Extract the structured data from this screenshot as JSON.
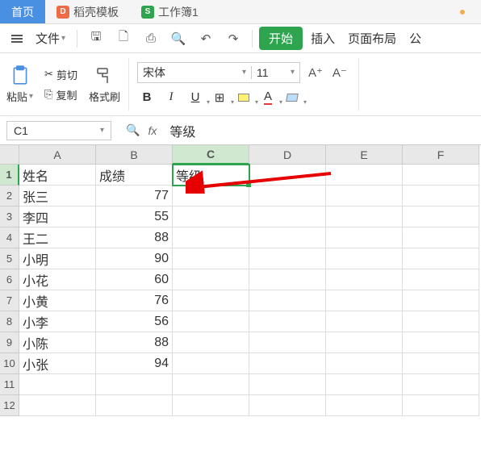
{
  "tabs": {
    "home": "首页",
    "docer": "稻壳模板",
    "workbook": "工作簿1"
  },
  "menubar": {
    "file": "文件",
    "start": "开始",
    "insert": "插入",
    "page_layout": "页面布局",
    "formula_partial": "公"
  },
  "ribbon": {
    "paste": "粘贴",
    "cut": "剪切",
    "copy": "复制",
    "format_painter": "格式刷",
    "font_name": "宋体",
    "font_size": "11",
    "inc_font": "A⁺",
    "dec_font": "A⁻",
    "bold": "B",
    "italic": "I",
    "underline": "U",
    "font_color": "A"
  },
  "formula_bar": {
    "name_box": "C1",
    "fx_label": "fx",
    "formula": "等级"
  },
  "columns": [
    "A",
    "B",
    "C",
    "D",
    "E",
    "F"
  ],
  "row_numbers": [
    "1",
    "2",
    "3",
    "4",
    "5",
    "6",
    "7",
    "8",
    "9",
    "10",
    "11",
    "12"
  ],
  "selected_col_index": 2,
  "selected_row_index": 0,
  "chart_data": {
    "type": "table",
    "headers": [
      "姓名",
      "成绩",
      "等级"
    ],
    "rows": [
      {
        "name": "张三",
        "score": 77
      },
      {
        "name": "李四",
        "score": 55
      },
      {
        "name": "王二",
        "score": 88
      },
      {
        "name": "小明",
        "score": 90
      },
      {
        "name": "小花",
        "score": 60
      },
      {
        "name": "小黄",
        "score": 76
      },
      {
        "name": "小李",
        "score": 56
      },
      {
        "name": "小陈",
        "score": 88
      },
      {
        "name": "小张",
        "score": 94
      }
    ]
  }
}
